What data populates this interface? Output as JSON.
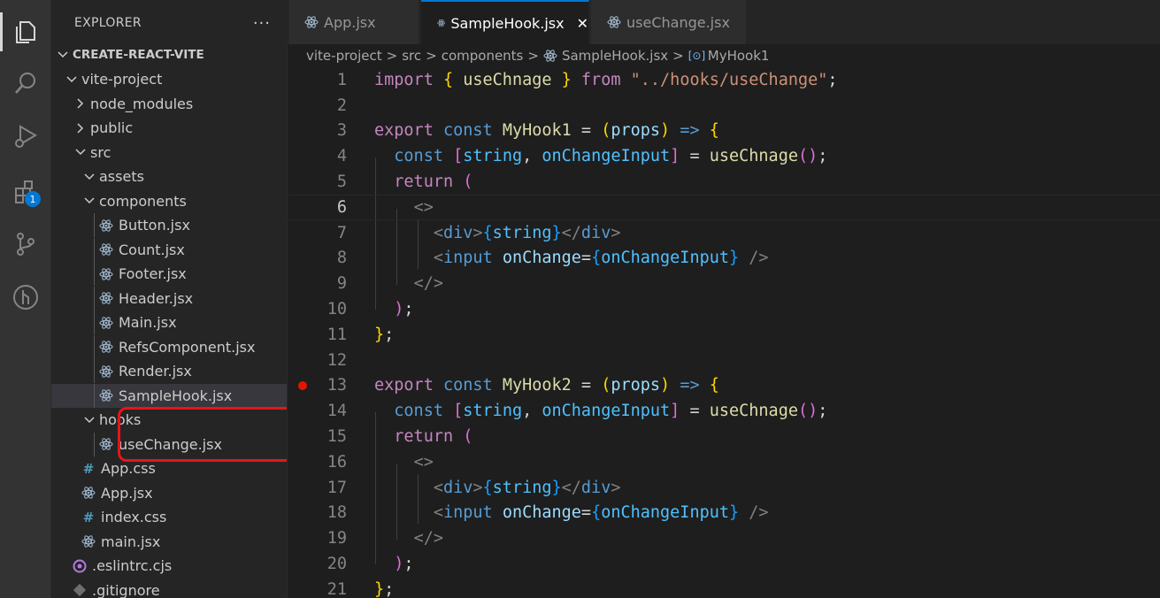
{
  "activity_bar": {
    "items": [
      {
        "icon": "files-icon",
        "active": true
      },
      {
        "icon": "search-icon"
      },
      {
        "icon": "run-debug-icon"
      },
      {
        "icon": "extensions-icon",
        "badge": "1"
      },
      {
        "icon": "source-control-icon"
      },
      {
        "icon": "git-graph-icon"
      }
    ]
  },
  "sidebar": {
    "title": "EXPLORER",
    "more": "···",
    "root": "CREATE-REACT-VITE",
    "tree": [
      {
        "label": "vite-project",
        "kind": "folder-open"
      },
      {
        "label": "node_modules",
        "kind": "folder-closed"
      },
      {
        "label": "public",
        "kind": "folder-closed"
      },
      {
        "label": "src",
        "kind": "folder-open"
      },
      {
        "label": "assets",
        "kind": "folder-open"
      },
      {
        "label": "components",
        "kind": "folder-open"
      },
      {
        "label": "Button.jsx",
        "kind": "react"
      },
      {
        "label": "Count.jsx",
        "kind": "react"
      },
      {
        "label": "Footer.jsx",
        "kind": "react"
      },
      {
        "label": "Header.jsx",
        "kind": "react"
      },
      {
        "label": "Main.jsx",
        "kind": "react"
      },
      {
        "label": "RefsComponent.jsx",
        "kind": "react"
      },
      {
        "label": "Render.jsx",
        "kind": "react"
      },
      {
        "label": "SampleHook.jsx",
        "kind": "react",
        "selected": true
      },
      {
        "label": "hooks",
        "kind": "folder-open"
      },
      {
        "label": "useChange.jsx",
        "kind": "react"
      },
      {
        "label": "App.css",
        "kind": "css"
      },
      {
        "label": "App.jsx",
        "kind": "react"
      },
      {
        "label": "index.css",
        "kind": "css"
      },
      {
        "label": "main.jsx",
        "kind": "react"
      },
      {
        "label": ".eslintrc.cjs",
        "kind": "eslint"
      },
      {
        "label": ".gitignore",
        "kind": "git"
      }
    ]
  },
  "tabs": [
    {
      "label": "App.jsx"
    },
    {
      "label": "SampleHook.jsx",
      "active": true,
      "close": "✕"
    },
    {
      "label": "useChange.jsx"
    }
  ],
  "breadcrumb": {
    "parts": [
      "vite-project",
      "src",
      "components",
      "SampleHook.jsx",
      "MyHook1"
    ],
    "separator": ">",
    "symbol_glyph": "[⊙]"
  },
  "editor": {
    "current_line": 6,
    "breakpoint_line": 13,
    "line_numbers": [
      "1",
      "2",
      "3",
      "4",
      "5",
      "6",
      "7",
      "8",
      "9",
      "10",
      "11",
      "12",
      "13",
      "14",
      "15",
      "16",
      "17",
      "18",
      "19",
      "20",
      "21"
    ],
    "tokens": {
      "import": "import",
      "from": "from",
      "export": "export",
      "const": "const",
      "return": "return",
      "useChnage": "useChnage",
      "import_path": "\"../hooks/useChange\"",
      "myhook1": "MyHook1",
      "myhook2": "MyHook2",
      "props": "props",
      "arrow": "=>",
      "string": "string",
      "onChangeInput": "onChangeInput",
      "div": "div",
      "input": "input",
      "onChange": "onChange",
      "fragment_open": "<>",
      "fragment_close": "</>"
    }
  },
  "colors": {
    "accent": "#0078d4",
    "highlight_box": "#e8141a",
    "breakpoint": "#e51400"
  }
}
